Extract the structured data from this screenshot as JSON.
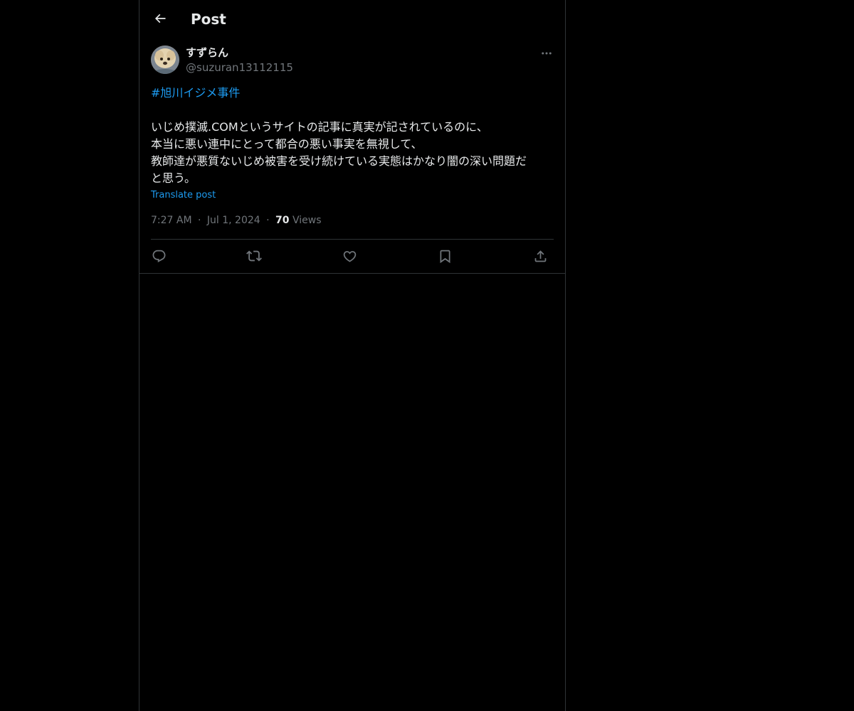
{
  "header": {
    "title": "Post",
    "back_icon": "arrow-left-icon"
  },
  "author": {
    "display_name": "すずらん",
    "handle": "@suzuran13112115",
    "avatar": "avatar-photo"
  },
  "post": {
    "hashtag": "#旭川イジメ事件",
    "lines": [
      "いじめ撲滅.COMというサイトの記事に真実が記されているのに、",
      "本当に悪い連中にとって都合の悪い事実を無視して、",
      "教師達が悪質ないじめ被害を受け続けている実態はかなり闇の深い問題だ",
      "と思う。"
    ],
    "translate_label": "Translate post",
    "time": "7:27 AM",
    "separator": "·",
    "date": "Jul 1, 2024",
    "views_count": "70",
    "views_label": "Views"
  },
  "actions": [
    "reply-icon",
    "repost-icon",
    "like-icon",
    "bookmark-icon",
    "share-icon"
  ],
  "colors": {
    "background": "#000000",
    "text": "#e7e9ea",
    "muted": "#71767b",
    "link": "#1d9bf0",
    "border": "#2f3336"
  }
}
